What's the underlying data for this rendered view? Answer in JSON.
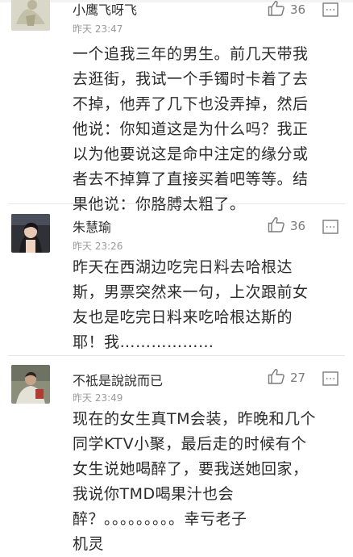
{
  "comments": [
    {
      "username": "小鹰飞呀飞",
      "time": "昨天 23:47",
      "likes": "36",
      "lines": [
        "一个追我三年的男生。前几天带我",
        "去逛街，我试一个手镯时卡着了去",
        "不掉，他弄了几下也没弄掉，然后",
        "他说：你知道这是为什么吗？我正",
        "以为他要说这是命中注定的缘分或",
        "者去不掉算了直接买着吧等等。结",
        "果他说：你胳膊太粗了。"
      ]
    },
    {
      "username": "朱慧瑜",
      "time": "昨天 23:26",
      "likes": "36",
      "lines": [
        "昨天在西湖边吃完日料去哈根达",
        "斯，男票突然来一句，上次跟前女",
        "友也是吃完日料来吃哈根达斯的",
        "耶！我………………"
      ]
    },
    {
      "username": "不祗是說說而已",
      "time": "昨天 23:49",
      "likes": "27",
      "lines": [
        "现在的女生真TM会装，昨晚和几个",
        "同学KTV小聚，最后走的时候有个",
        "女生说她喝醉了，要我送她回家，",
        "我说你TMD喝果汁也会",
        "醉？。。。。。。。。。幸亏老子",
        "机灵"
      ]
    }
  ],
  "icons": {
    "like": "thumbs-up-icon",
    "reply": "comment-reply-icon"
  },
  "colors": {
    "username": "#2d2d2d",
    "timestamp": "#9a9a9a",
    "body": "#2b2b2b",
    "icon": "#7a7a7a",
    "divider": "#e6e6e6"
  }
}
